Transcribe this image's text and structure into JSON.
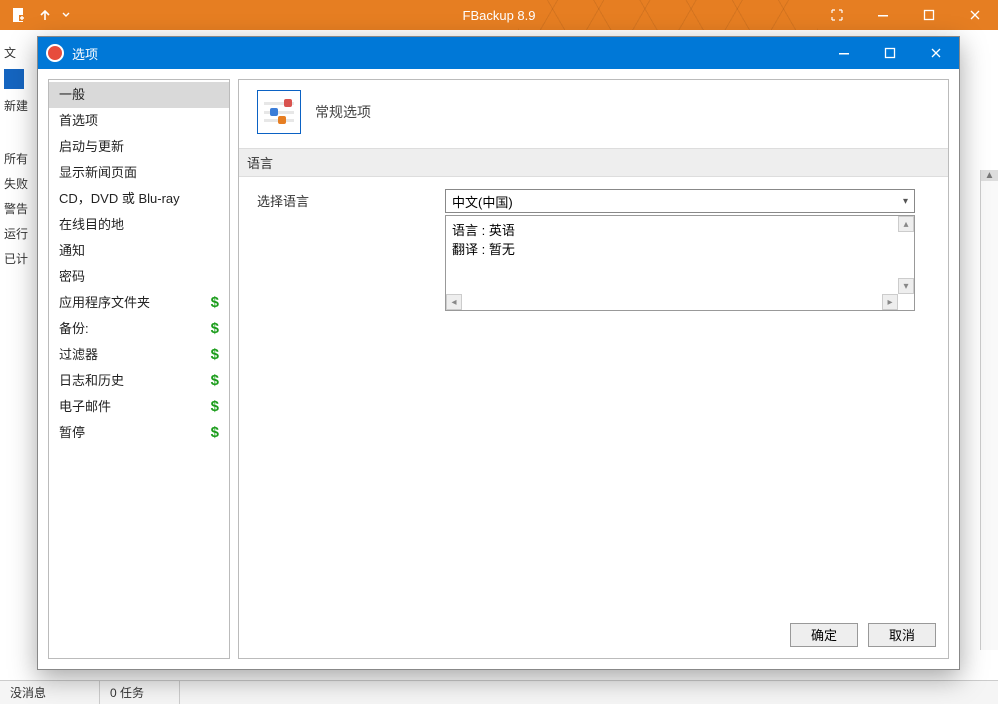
{
  "app": {
    "title": "FBackup 8.9",
    "toolbar": {
      "new_label": "新建"
    },
    "left_strip": [
      "文",
      "新建",
      " ",
      "所有",
      "失败",
      "警告",
      "运行",
      "已计"
    ],
    "statusbar": {
      "messages": "没消息",
      "tasks": "0 任务"
    }
  },
  "dialog": {
    "title": "选项",
    "sidebar": [
      {
        "label": "一般",
        "premium": false,
        "selected": true
      },
      {
        "label": "首选项",
        "premium": false,
        "selected": false
      },
      {
        "label": "启动与更新",
        "premium": false,
        "selected": false
      },
      {
        "label": "显示新闻页面",
        "premium": false,
        "selected": false
      },
      {
        "label": "CD，DVD 或 Blu-ray",
        "premium": false,
        "selected": false
      },
      {
        "label": "在线目的地",
        "premium": false,
        "selected": false
      },
      {
        "label": "通知",
        "premium": false,
        "selected": false
      },
      {
        "label": "密码",
        "premium": false,
        "selected": false
      },
      {
        "label": "应用程序文件夹",
        "premium": true,
        "selected": false
      },
      {
        "label": "备份:",
        "premium": true,
        "selected": false
      },
      {
        "label": "过滤器",
        "premium": true,
        "selected": false
      },
      {
        "label": "日志和历史",
        "premium": true,
        "selected": false
      },
      {
        "label": "电子邮件",
        "premium": true,
        "selected": false
      },
      {
        "label": "暂停",
        "premium": true,
        "selected": false
      }
    ],
    "main": {
      "header_title": "常规选项",
      "section_language": "语言",
      "label_select_language": "选择语言",
      "dropdown_value": "中文(中国)",
      "info_line1": "语言 : 英语",
      "info_line2": "翻译 : 暂无"
    },
    "buttons": {
      "ok": "确定",
      "cancel": "取消"
    }
  }
}
